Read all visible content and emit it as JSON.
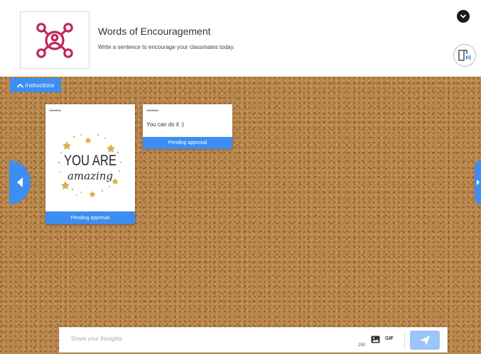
{
  "activity": {
    "title": "Words of Encouragement",
    "subtitle": "Write a sentence to encourage your classmates today."
  },
  "board": {
    "instructions_label": "Instructions"
  },
  "cards": [
    {
      "author": "*********",
      "image_text_1": "YOU ARE",
      "image_text_2": "amazing",
      "status": "Pending approval"
    },
    {
      "author": "*********",
      "text": "You can do it :)",
      "status": "Pending approval"
    }
  ],
  "composer": {
    "placeholder": "Share your thoughts",
    "char_count": "250",
    "gif_label": "GIF"
  },
  "colors": {
    "accent": "#3d8ef0",
    "logo_magenta": "#c0285a",
    "cork": "#b9864d"
  },
  "icons": [
    "network-people-icon",
    "chevron-down-icon",
    "immersive-reader-icon",
    "chevron-up-icon",
    "chevron-left-icon",
    "chevron-right-icon",
    "image-icon",
    "send-icon"
  ]
}
